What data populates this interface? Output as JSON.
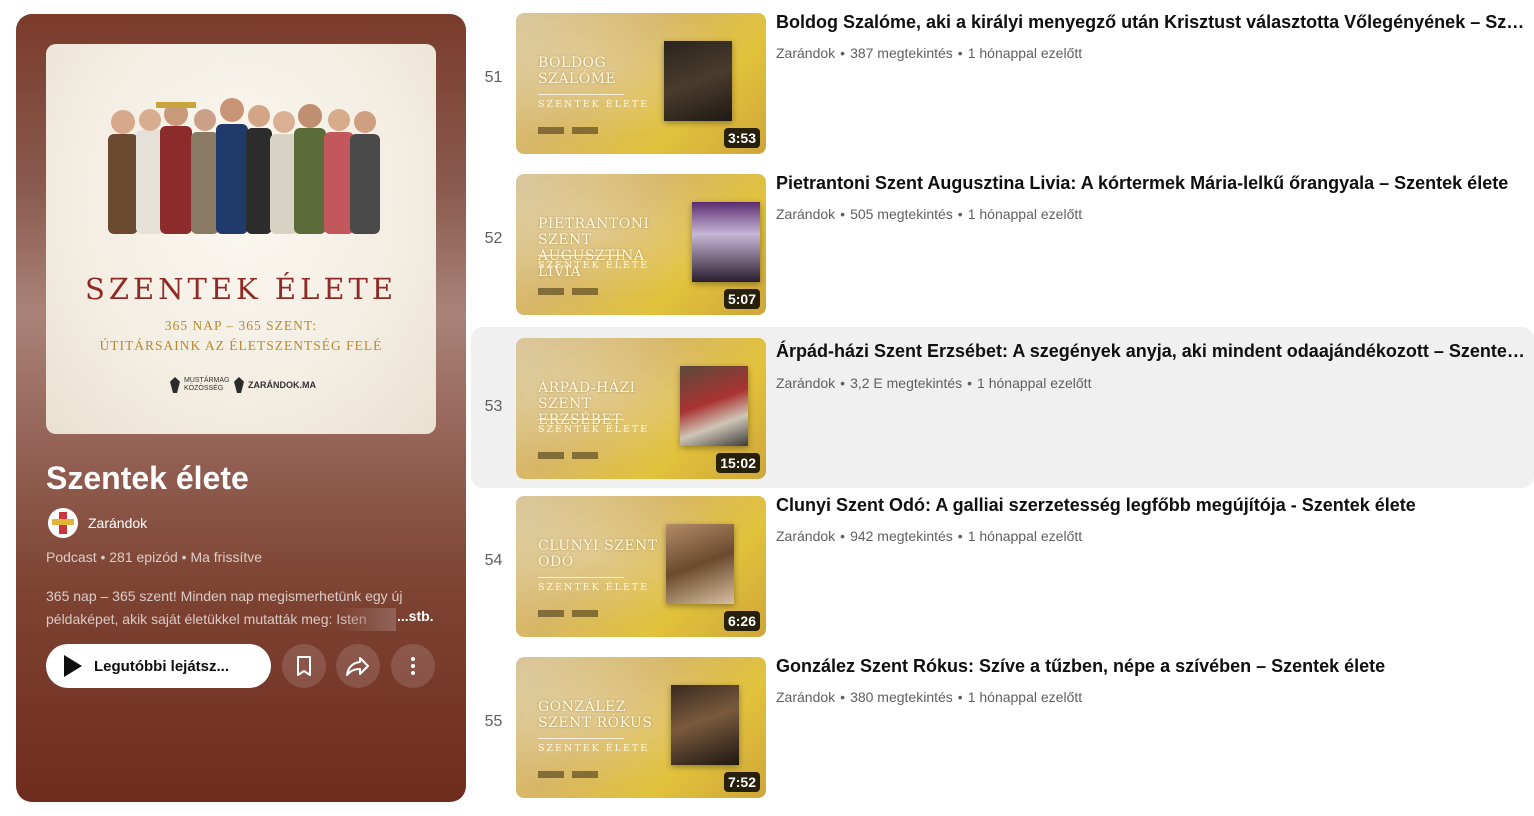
{
  "playlist": {
    "cover": {
      "title": "SZENTEK ÉLETE",
      "subtitle1": "365 NAP – 365 SZENT:",
      "subtitle2": "ÚTITÁRSAINK AZ ÉLETSZENTSÉG FELÉ",
      "logo1": "MUSTÁRMAG KÖZÖSSÉG",
      "logo2": "ZARÁNDOK.MA"
    },
    "title": "Szentek élete",
    "owner": "Zarándok",
    "meta": "Podcast • 281 epizód • Ma frissítve",
    "description": "365 nap – 365 szent! Minden nap megismerhetünk egy új példaképet, akik saját életükkel mutatták meg: Isten",
    "more_label": "...stb.",
    "play_label": "Legutóbbi lejátsz...",
    "save_icon": "bookmark-icon",
    "share_icon": "share-icon",
    "more_icon": "more-vertical-icon"
  },
  "videos": [
    {
      "index": "51",
      "title": "Boldog Szalóme, aki a királyi menyegző után Krisztust választotta Vőlegényének – Szentek élete",
      "channel": "Zarándok",
      "views": "387 megtekintés",
      "age": "1 hónappal ezelőtt",
      "duration": "3:53",
      "thumb_name": "BOLDOG SZALÓME",
      "thumb_sub": "SZENTEK ÉLETE"
    },
    {
      "index": "52",
      "title": "Pietrantoni Szent Augusztina Livia: A kórtermek Mária-lelkű őrangyala – Szentek élete",
      "channel": "Zarándok",
      "views": "505 megtekintés",
      "age": "1 hónappal ezelőtt",
      "duration": "5:07",
      "thumb_name": "PIETRANTONI SZENT AUGUSZTINA LIVIA",
      "thumb_sub": "SZENTEK ÉLETE"
    },
    {
      "index": "53",
      "title": "Árpád-házi Szent Erzsébet: A szegények anyja, aki mindent odaajándékozott – Szentek élete",
      "channel": "Zarándok",
      "views": "3,2 E megtekintés",
      "age": "1 hónappal ezelőtt",
      "duration": "15:02",
      "thumb_name": "ÁRPÁD-HÁZI SZENT ERZSÉBET",
      "thumb_sub": "SZENTEK ÉLETE"
    },
    {
      "index": "54",
      "title": "Clunyi Szent Odó: A galliai szerzetesség legfőbb megújítója - Szentek élete",
      "channel": "Zarándok",
      "views": "942 megtekintés",
      "age": "1 hónappal ezelőtt",
      "duration": "6:26",
      "thumb_name": "CLUNYI SZENT ODÓ",
      "thumb_sub": "SZENTEK ÉLETE"
    },
    {
      "index": "55",
      "title": "González Szent Rókus: Szíve a tűzben, népe a szívében – Szentek élete",
      "channel": "Zarándok",
      "views": "380 megtekintés",
      "age": "1 hónappal ezelőtt",
      "duration": "7:52",
      "thumb_name": "GONZÁLEZ SZENT RÓKUS",
      "thumb_sub": "SZENTEK ÉLETE"
    }
  ],
  "separator": "•",
  "colors": {
    "panel_top": "#7a3b2c",
    "panel_bottom": "#6e2c1e",
    "cover_title": "#8e2b25",
    "thumb_gold": "#e2c23b",
    "active_row": "#f0f0f0"
  }
}
